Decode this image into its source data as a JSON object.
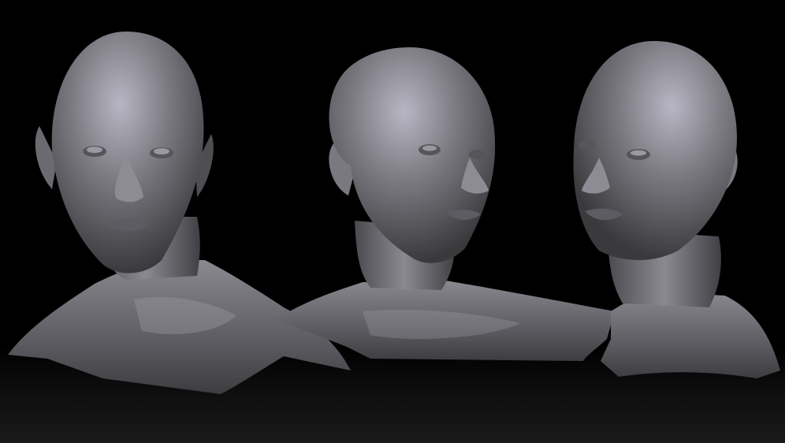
{
  "scene": {
    "background_color": "#000000",
    "floor_gradient_color": "#1a1a1a",
    "clay_colors": {
      "base": "#6f6f73",
      "shadow": "#3a3a3d",
      "highlight": "#b9b6c4"
    },
    "figures": [
      {
        "name": "bust-front-view"
      },
      {
        "name": "bust-three-quarter-right-view"
      },
      {
        "name": "bust-three-quarter-left-view"
      }
    ]
  }
}
